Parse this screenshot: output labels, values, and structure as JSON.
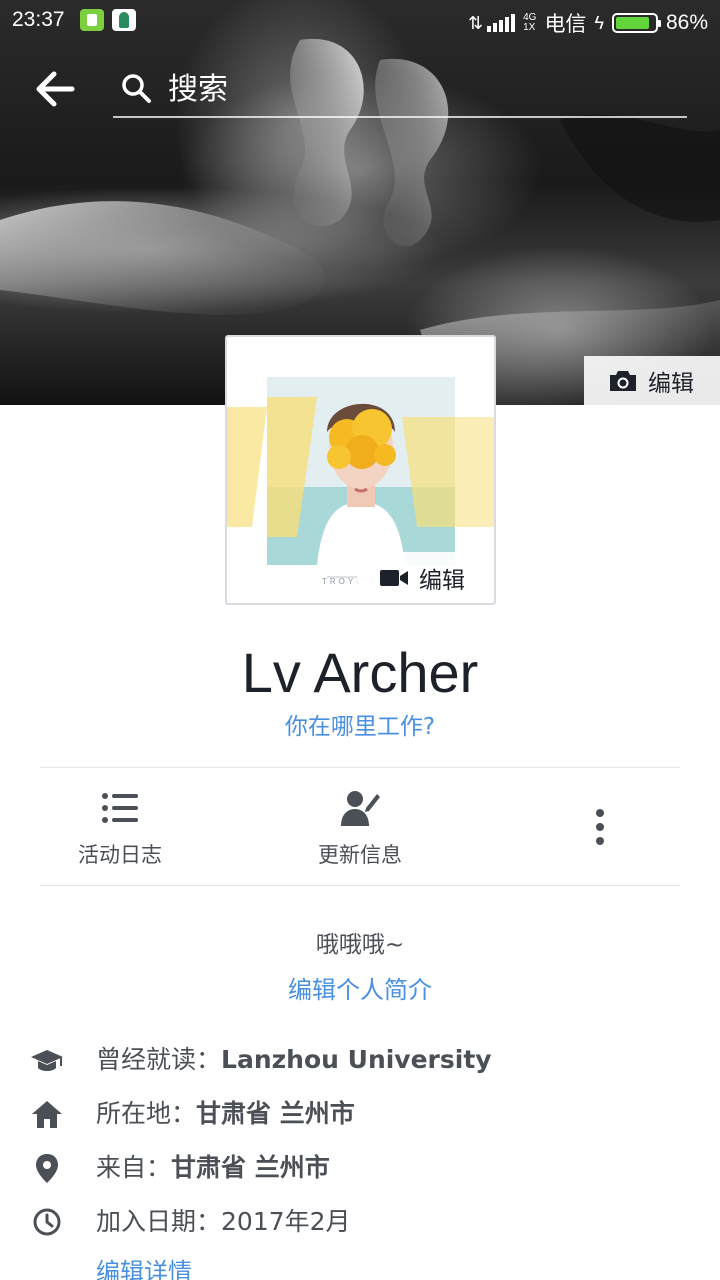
{
  "status_bar": {
    "time": "23:37",
    "carrier": "电信",
    "network_top": "4G",
    "network_bottom": "1X",
    "battery_percent": "86%",
    "battery_level": 0.86
  },
  "search": {
    "placeholder": "搜索"
  },
  "cover": {
    "edit_label": "编辑"
  },
  "avatar": {
    "edit_label": "编辑",
    "art_text": "TROYE SI"
  },
  "profile": {
    "name": "Lv Archer",
    "work_prompt": "你在哪里工作?"
  },
  "actions": {
    "activity_log": "活动日志",
    "update_info": "更新信息"
  },
  "bio": {
    "text": "哦哦哦~",
    "edit_label": "编辑个人简介"
  },
  "info": {
    "studied_label": "曾经就读：",
    "studied_value": "Lanzhou University",
    "lives_label": "所在地：",
    "lives_value": "甘肃省 兰州市",
    "from_label": "来自：",
    "from_value": "甘肃省 兰州市",
    "joined_label": "加入日期：",
    "joined_value": "2017年2月",
    "edit_details": "编辑详情"
  },
  "colors": {
    "link_blue": "#4a90e2",
    "icon_gray": "#4b4f56",
    "battery_green": "#62d53a"
  },
  "icons": [
    "back-arrow-icon",
    "search-icon",
    "camera-icon",
    "video-camera-icon",
    "list-icon",
    "person-edit-icon",
    "more-vertical-icon",
    "graduation-cap-icon",
    "home-icon",
    "location-pin-icon",
    "clock-icon"
  ]
}
